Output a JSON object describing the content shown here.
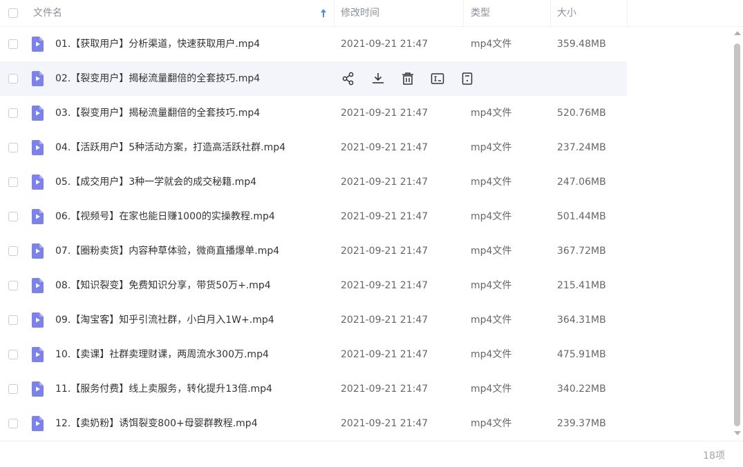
{
  "header": {
    "col_name": "文件名",
    "col_time": "修改时间",
    "col_type": "类型",
    "col_size": "大小"
  },
  "files": [
    {
      "name": "01.【获取用户】分析渠道，快速获取用户.mp4",
      "time": "2021-09-21 21:47",
      "type": "mp4文件",
      "size": "359.48MB"
    },
    {
      "name": "02.【裂变用户】揭秘流量翻倍的全套技巧.mp4",
      "time": "",
      "type": "",
      "size": ""
    },
    {
      "name": "03.【裂变用户】揭秘流量翻倍的全套技巧.mp4",
      "time": "2021-09-21 21:47",
      "type": "mp4文件",
      "size": "520.76MB"
    },
    {
      "name": "04.【活跃用户】5种活动方案，打造高活跃社群.mp4",
      "time": "2021-09-21 21:47",
      "type": "mp4文件",
      "size": "237.24MB"
    },
    {
      "name": "05.【成交用户】3种一学就会的成交秘籍.mp4",
      "time": "2021-09-21 21:47",
      "type": "mp4文件",
      "size": "247.06MB"
    },
    {
      "name": "06.【视频号】在家也能日赚1000的实操教程.mp4",
      "time": "2021-09-21 21:47",
      "type": "mp4文件",
      "size": "501.44MB"
    },
    {
      "name": "07.【圈粉卖货】内容种草体验，微商直播爆单.mp4",
      "time": "2021-09-21 21:47",
      "type": "mp4文件",
      "size": "367.72MB"
    },
    {
      "name": "08.【知识裂变】免费知识分享，带货50万+.mp4",
      "time": "2021-09-21 21:47",
      "type": "mp4文件",
      "size": "215.41MB"
    },
    {
      "name": "09.【淘宝客】知乎引流社群，小白月入1W+.mp4",
      "time": "2021-09-21 21:47",
      "type": "mp4文件",
      "size": "364.31MB"
    },
    {
      "name": "10.【卖课】社群卖理财课，两周流水300万.mp4",
      "time": "2021-09-21 21:47",
      "type": "mp4文件",
      "size": "475.91MB"
    },
    {
      "name": "11.【服务付费】线上卖服务，转化提升13倍.mp4",
      "time": "2021-09-21 21:47",
      "type": "mp4文件",
      "size": "340.22MB"
    },
    {
      "name": "12.【卖奶粉】诱饵裂变800+母婴群教程.mp4",
      "time": "2021-09-21 21:47",
      "type": "mp4文件",
      "size": "239.37MB"
    }
  ],
  "hover_row_index": 1,
  "row_actions": [
    "share-icon",
    "download-icon",
    "delete-icon",
    "rename-icon",
    "more-icon"
  ],
  "footer": {
    "count": "18项"
  },
  "colors": {
    "accent": "#4a8cff",
    "file_icon": "#7b82ee",
    "hover_bg": "#f3f5fa"
  }
}
